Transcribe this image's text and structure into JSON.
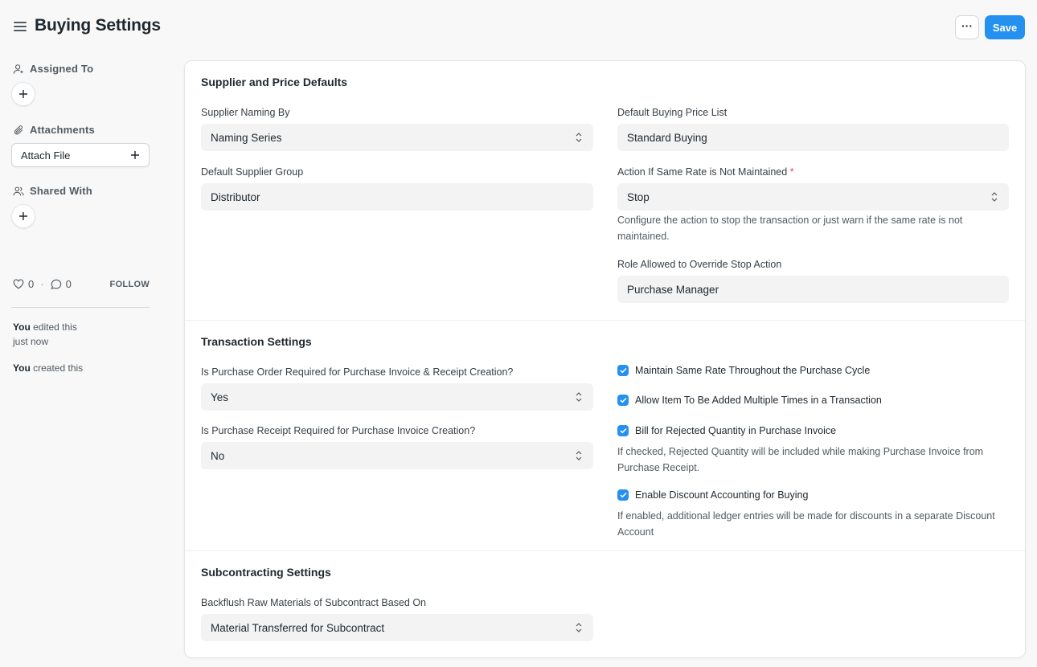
{
  "header": {
    "title": "Buying Settings",
    "more_label": "···",
    "save_label": "Save"
  },
  "sidebar": {
    "assigned_to": "Assigned To",
    "attachments": "Attachments",
    "attach_file": "Attach File",
    "shared_with": "Shared With",
    "likes": "0",
    "comments": "0",
    "follow": "FOLLOW",
    "activity": [
      {
        "actor": "You",
        "text": "edited this",
        "time": "just now"
      },
      {
        "actor": "You",
        "text": "created this"
      }
    ]
  },
  "sections": {
    "supplier": {
      "title": "Supplier and Price Defaults",
      "supplier_naming_label": "Supplier Naming By",
      "supplier_naming_value": "Naming Series",
      "default_supplier_group_label": "Default Supplier Group",
      "default_supplier_group_value": "Distributor",
      "default_price_list_label": "Default Buying Price List",
      "default_price_list_value": "Standard Buying",
      "same_rate_action_label": "Action If Same Rate is Not Maintained",
      "same_rate_action_value": "Stop",
      "same_rate_action_desc_1": "Configure the action to stop the transaction or just warn if the same rate is not",
      "same_rate_action_desc_2": "maintained.",
      "role_override_label": "Role Allowed to Override Stop Action",
      "role_override_value": "Purchase Manager"
    },
    "transaction": {
      "title": "Transaction Settings",
      "po_required_label": "Is Purchase Order Required for Purchase Invoice & Receipt Creation?",
      "po_required_value": "Yes",
      "pr_required_label": "Is Purchase Receipt Required for Purchase Invoice Creation?",
      "pr_required_value": "No",
      "checks": {
        "maintain_same_rate": "Maintain Same Rate Throughout the Purchase Cycle",
        "allow_multiple_items": "Allow Item To Be Added Multiple Times in a Transaction",
        "bill_rejected_qty": "Bill for Rejected Quantity in Purchase Invoice",
        "bill_rejected_desc_1": "If checked, Rejected Quantity will be included while making Purchase Invoice from",
        "bill_rejected_desc_2": "Purchase Receipt.",
        "enable_discount_accounting": "Enable Discount Accounting for Buying",
        "discount_desc_1": "If enabled, additional ledger entries will be made for discounts in a separate Discount",
        "discount_desc_2": "Account"
      }
    },
    "subcontracting": {
      "title": "Subcontracting Settings",
      "backflush_label": "Backflush Raw Materials of Subcontract Based On",
      "backflush_value": "Material Transferred for Subcontract"
    }
  },
  "colors": {
    "primary": "#2490ef",
    "field_bg": "#f3f3f3",
    "required": "#e24c4c"
  }
}
